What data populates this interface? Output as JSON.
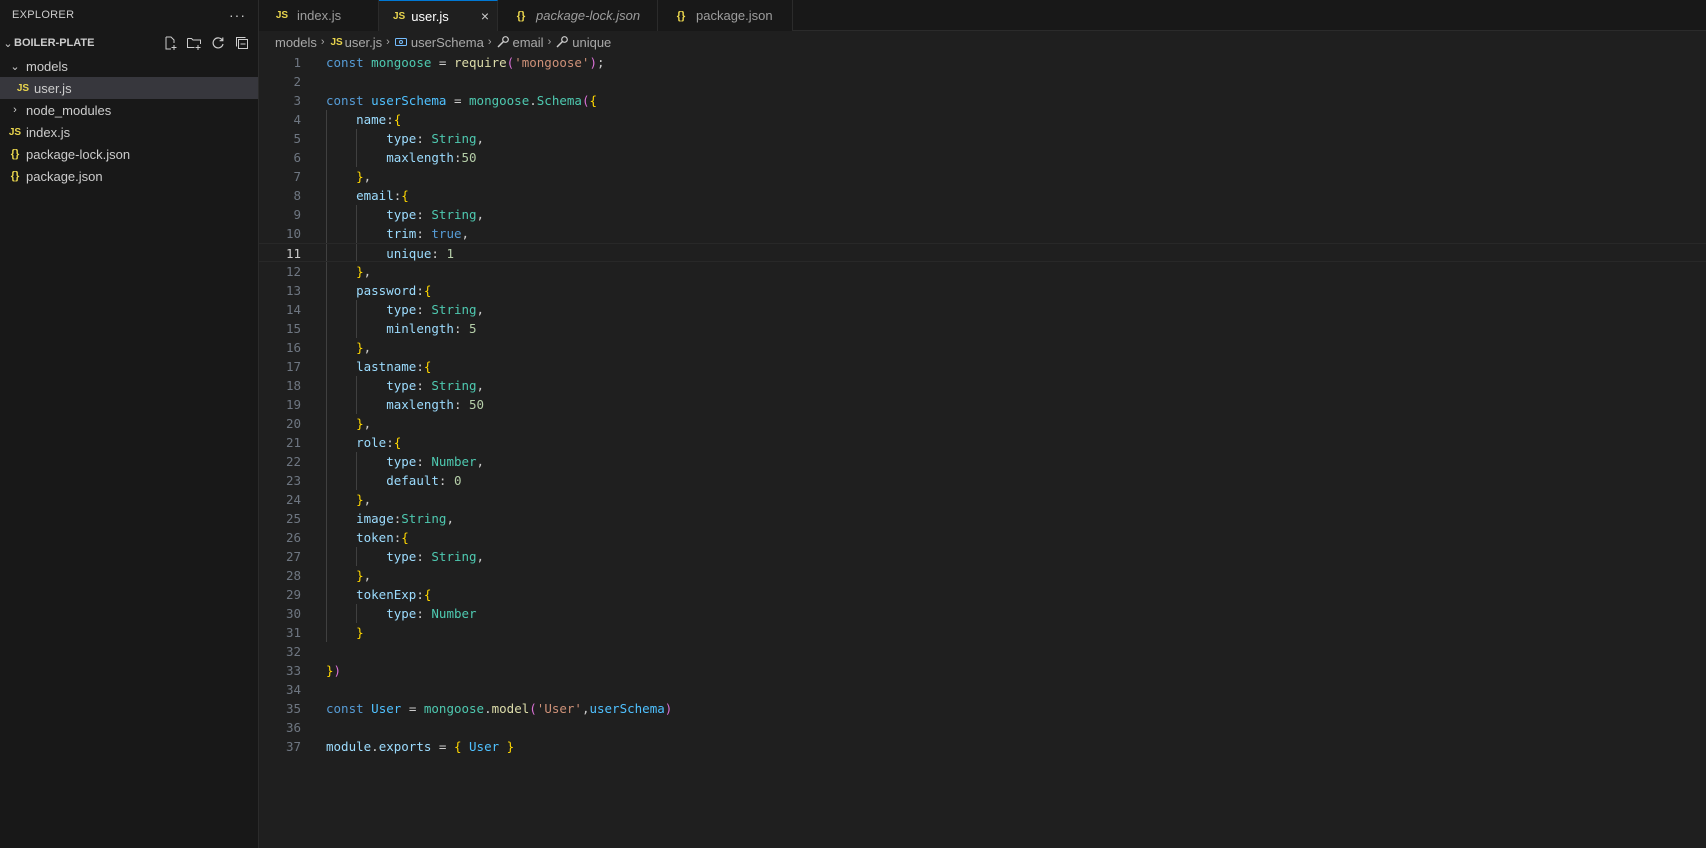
{
  "sidebar": {
    "title": "EXPLORER",
    "more_label": "···",
    "workspace": "BOILER-PLATE",
    "tree": [
      {
        "label": "models",
        "kind": "folder-open"
      },
      {
        "label": "user.js",
        "kind": "js",
        "selected": true
      },
      {
        "label": "node_modules",
        "kind": "folder-closed"
      },
      {
        "label": "index.js",
        "kind": "js"
      },
      {
        "label": "package-lock.json",
        "kind": "json"
      },
      {
        "label": "package.json",
        "kind": "json"
      }
    ],
    "js_icon": "JS",
    "json_icon": "{}"
  },
  "tabs": [
    {
      "label": "index.js",
      "icon": "JS"
    },
    {
      "label": "user.js",
      "icon": "JS",
      "active": true,
      "close": "×"
    },
    {
      "label": "package-lock.json",
      "icon": "{}"
    },
    {
      "label": "package.json",
      "icon": "{}"
    }
  ],
  "breadcrumb": {
    "items": [
      "models",
      "user.js",
      "userSchema",
      "email",
      "unique"
    ],
    "file_icon": "JS"
  },
  "editor": {
    "current_line": 11,
    "lines": [
      "const mongoose = require('mongoose');",
      "",
      "const userSchema = mongoose.Schema({",
      "    name:{",
      "        type: String,",
      "        maxlength:50",
      "    },",
      "    email:{",
      "        type: String,",
      "        trim: true,",
      "        unique: 1",
      "    },",
      "    password:{",
      "        type: String,",
      "        minlength: 5",
      "    },",
      "    lastname:{",
      "        type: String,",
      "        maxlength: 50",
      "    },",
      "    role:{",
      "        type: Number,",
      "        default: 0",
      "    },",
      "    image:String,",
      "    token:{",
      "        type: String,",
      "    },",
      "    tokenExp:{",
      "        type: Number",
      "    }",
      "",
      "})",
      "",
      "const User = mongoose.model('User',userSchema)",
      "",
      "module.exports = { User }"
    ]
  },
  "colors": {
    "accent": "#0078d4",
    "keyword": "#569cd6",
    "string": "#ce9178",
    "property": "#9cdcfe",
    "type": "#4ec9b0",
    "number": "#b5cea8"
  }
}
